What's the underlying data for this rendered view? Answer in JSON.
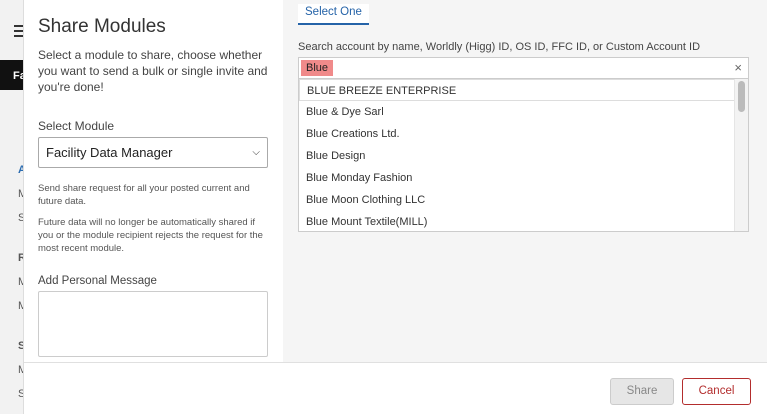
{
  "background": {
    "tab_label": "Fa",
    "letters": [
      "A",
      "M",
      "S",
      "R",
      "M",
      "M",
      "S",
      "M",
      "S"
    ]
  },
  "modal": {
    "title": "Share Modules",
    "intro": "Select a module to share, choose whether you want to send a bulk or single invite and you're done!",
    "select_label": "Select Module",
    "selected_module": "Facility Data Manager",
    "note_1": "Send share request for all your posted current and future data.",
    "note_2": "Future data will no longer be automatically shared if you or the module recipient rejects the request for the most recent module.",
    "message_label": "Add Personal Message",
    "message_value": ""
  },
  "right": {
    "tab_label": "Select One",
    "search_label": "Search account by name, Worldly (Higg) ID, OS ID, FFC ID, or Custom Account ID",
    "search_value": "Blue",
    "results": [
      "BLUE BREEZE ENTERPRISE",
      "Blue & Dye Sarl",
      "Blue Creations Ltd.",
      "Blue Design",
      "Blue Monday Fashion",
      "Blue Moon Clothing LLC",
      "Blue Mount Textile(MILL)"
    ]
  },
  "footer": {
    "share_label": "Share",
    "cancel_label": "Cancel"
  },
  "icons": {
    "clear": "close-icon",
    "dropdown": "chevron-down-icon",
    "menu": "hamburger-icon"
  }
}
